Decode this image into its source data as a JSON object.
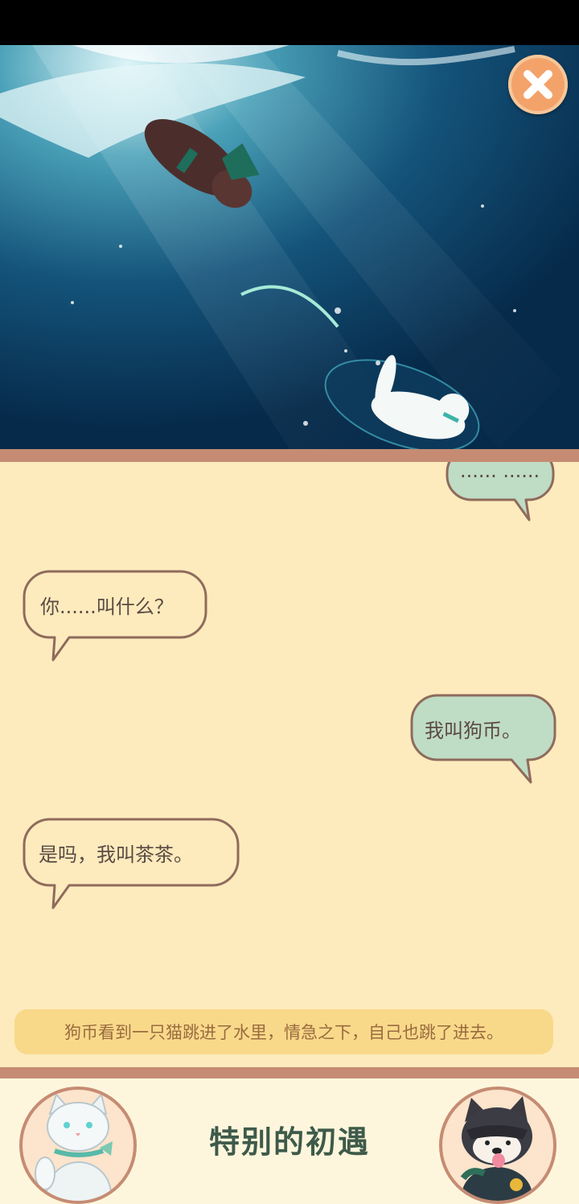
{
  "scene": {
    "icon": "underwater-scene-illustration"
  },
  "close_button": {
    "icon": "close-icon"
  },
  "dialogue": [
    {
      "speaker": "right",
      "text": "...... ......"
    },
    {
      "speaker": "left",
      "text": "你......叫什么？"
    },
    {
      "speaker": "right",
      "text": "我叫狗币。"
    },
    {
      "speaker": "left",
      "text": "是吗，我叫茶茶。"
    }
  ],
  "narration": "狗币看到一只猫跳进了水里，情急之下，自己也跳了进去。",
  "chapter_title": "特别的初遇",
  "avatars": {
    "left": "cat-avatar",
    "right": "shiba-dog-avatar"
  },
  "colors": {
    "background": "#fdebbd",
    "bubble_left": "#fdebbd",
    "bubble_right": "#bfdcc5",
    "border": "#8f6b5c",
    "title": "#3e5a4a"
  }
}
